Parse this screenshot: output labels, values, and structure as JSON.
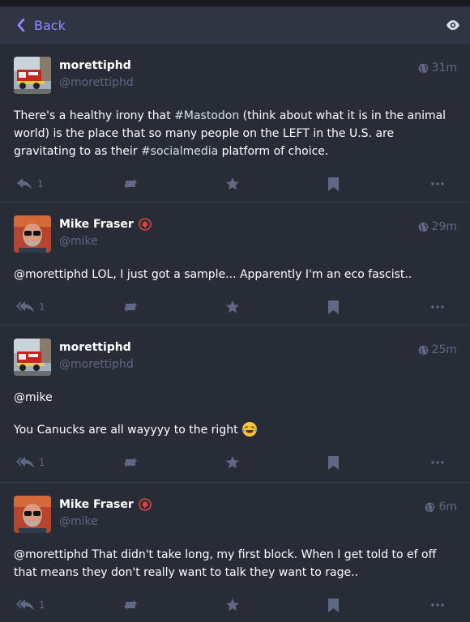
{
  "header": {
    "back_label": "Back",
    "eye_icon": "eye-icon"
  },
  "statuses": [
    {
      "display_name": "morettiphd",
      "handle": "@morettiphd",
      "time": "31m",
      "avatar": "fire-truck",
      "badge": false,
      "content_parts": [
        "There's a healthy irony that ",
        "#Mastodon",
        " (think about what it is in the animal world) is the place that so many people on the LEFT in the U.S. are gravitating to as their ",
        "#socialmedia",
        " platform of choice."
      ],
      "replies": "1"
    },
    {
      "display_name": "Mike Fraser",
      "handle": "@mike",
      "time": "29m",
      "avatar": "bearded-man",
      "badge": true,
      "content": "@morettiphd LOL, I just got a sample... Apparently I'm an eco fascist..",
      "replies": "1"
    },
    {
      "display_name": "morettiphd",
      "handle": "@morettiphd",
      "time": "25m",
      "avatar": "fire-truck",
      "badge": false,
      "content_line1": "@mike",
      "content_line2": "You Canucks are all wayyyy to the right",
      "replies": "1"
    },
    {
      "display_name": "Mike Fraser",
      "handle": "@mike",
      "time": "6m",
      "avatar": "bearded-man",
      "badge": true,
      "content": "@morettiphd That didn't take long, my first block. When I get told to ef off that means they don't really want to talk they want to rage..",
      "replies": "1"
    }
  ],
  "colors": {
    "accent": "#8c8dff",
    "muted": "#606984",
    "background": "#282c37"
  }
}
